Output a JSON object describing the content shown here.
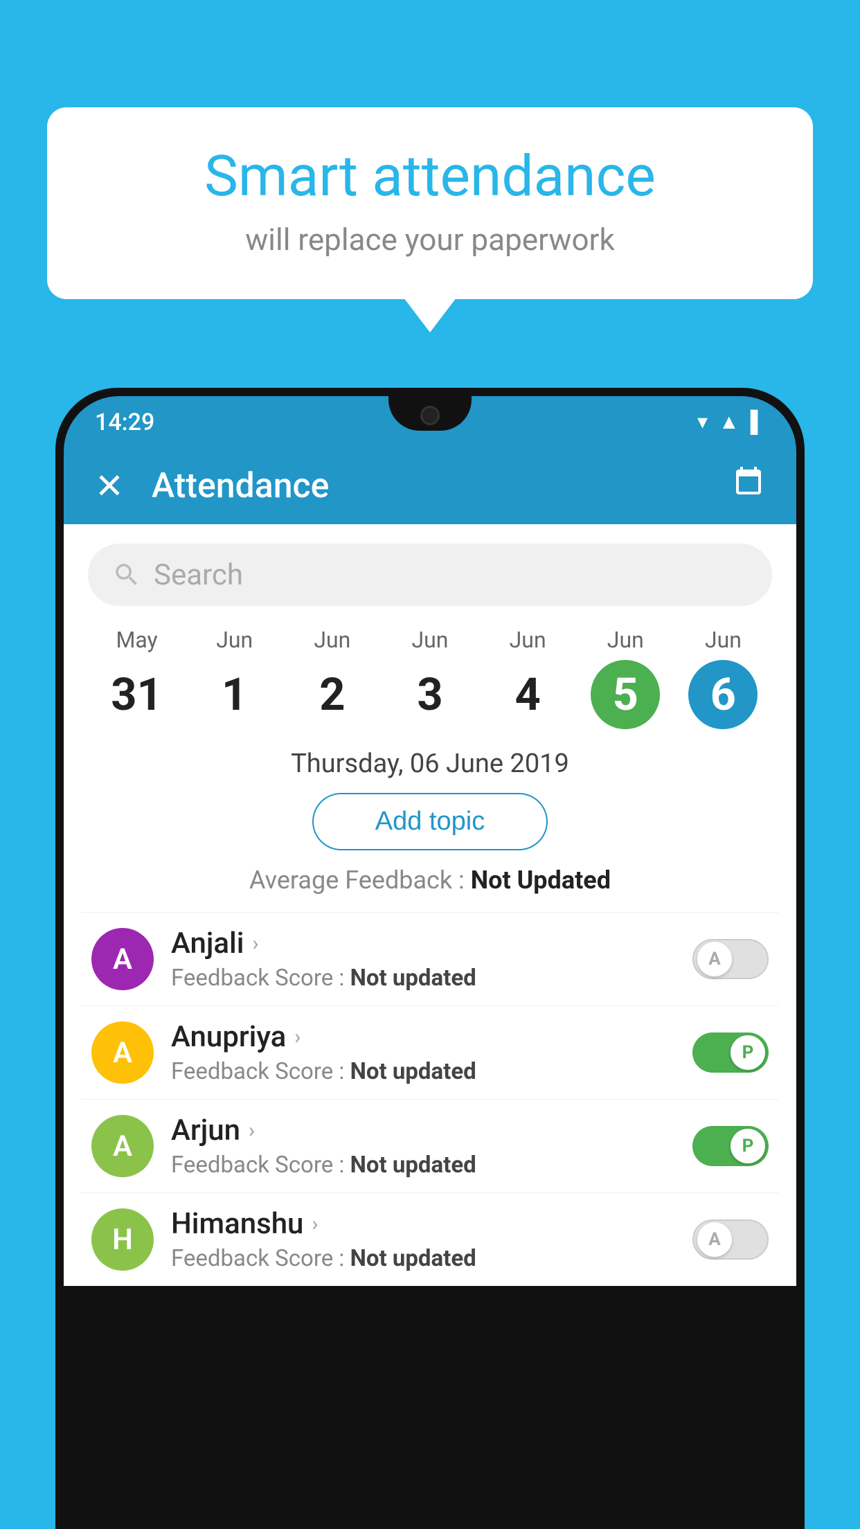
{
  "background": {
    "color": "#29b6e8"
  },
  "bubble": {
    "title": "Smart attendance",
    "subtitle": "will replace your paperwork"
  },
  "status_bar": {
    "time": "14:29"
  },
  "header": {
    "title": "Attendance",
    "close_label": "×",
    "calendar_label": "📅"
  },
  "search": {
    "placeholder": "Search"
  },
  "calendar": {
    "columns": [
      {
        "month": "May",
        "day": "31",
        "type": "normal"
      },
      {
        "month": "Jun",
        "day": "1",
        "type": "normal"
      },
      {
        "month": "Jun",
        "day": "2",
        "type": "normal"
      },
      {
        "month": "Jun",
        "day": "3",
        "type": "normal"
      },
      {
        "month": "Jun",
        "day": "4",
        "type": "normal"
      },
      {
        "month": "Jun",
        "day": "5",
        "type": "today"
      },
      {
        "month": "Jun",
        "day": "6",
        "type": "selected"
      }
    ]
  },
  "date_label": "Thursday, 06 June 2019",
  "add_topic_label": "Add topic",
  "avg_feedback_label": "Average Feedback : ",
  "avg_feedback_value": "Not Updated",
  "students": [
    {
      "name": "Anjali",
      "initial": "A",
      "color": "#9c27b0",
      "feedback": "Not updated",
      "toggle": "off"
    },
    {
      "name": "Anupriya",
      "initial": "A",
      "color": "#ffc107",
      "feedback": "Not updated",
      "toggle": "on"
    },
    {
      "name": "Arjun",
      "initial": "A",
      "color": "#8bc34a",
      "feedback": "Not updated",
      "toggle": "on"
    },
    {
      "name": "Himanshu",
      "initial": "H",
      "color": "#8bc34a",
      "feedback": "Not updated",
      "toggle": "off"
    }
  ],
  "feedback_label": "Feedback Score : "
}
